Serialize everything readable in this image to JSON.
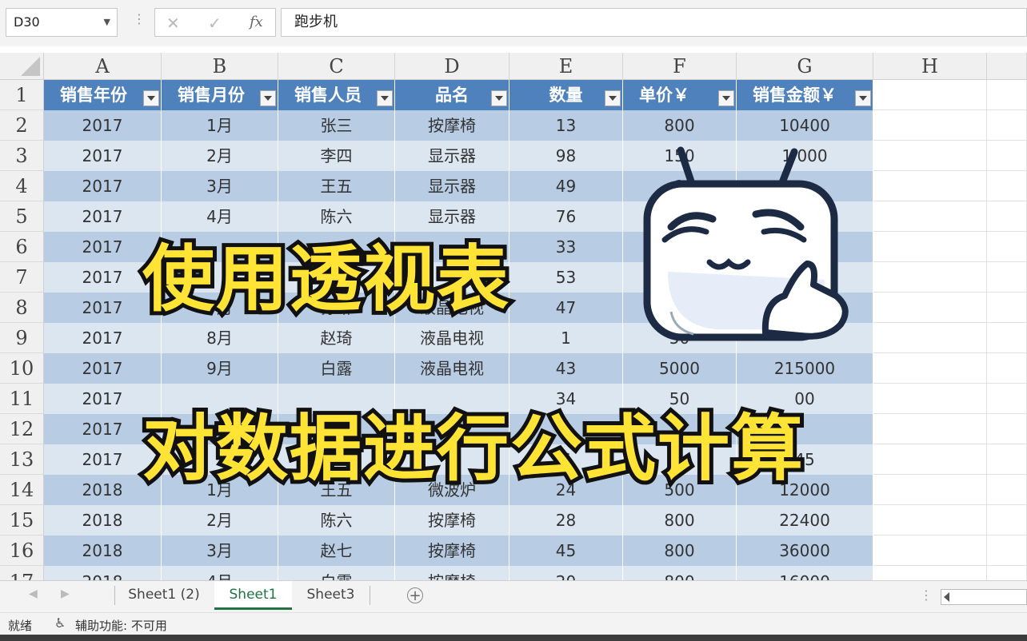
{
  "formula_bar": {
    "name_box": "D30",
    "cancel_icon": "✕",
    "confirm_icon": "✓",
    "fx_icon": "fx",
    "content": "跑步机"
  },
  "columns": [
    "A",
    "B",
    "C",
    "D",
    "E",
    "F",
    "G",
    "H"
  ],
  "table": {
    "headers": [
      "销售年份",
      "销售月份",
      "销售人员",
      "品名",
      "数量",
      "单价￥",
      "销售金额￥"
    ],
    "rows": [
      [
        "2017",
        "1月",
        "张三",
        "按摩椅",
        "13",
        "800",
        "10400"
      ],
      [
        "2017",
        "2月",
        "李四",
        "显示器",
        "98",
        "150",
        "1  000"
      ],
      [
        "2017",
        "3月",
        "王五",
        "显示器",
        "49",
        "1",
        ""
      ],
      [
        "2017",
        "4月",
        "陈六",
        "显示器",
        "76",
        "",
        ""
      ],
      [
        "2017",
        "",
        "",
        "",
        "33",
        "",
        ""
      ],
      [
        "2017",
        "",
        "",
        "",
        "53",
        "",
        ""
      ],
      [
        "2017",
        "7月",
        "孙琳",
        "液晶电视",
        "47",
        "",
        ""
      ],
      [
        "2017",
        "8月",
        "赵琦",
        "液晶电视",
        "1",
        "50",
        ""
      ],
      [
        "2017",
        "9月",
        "白露",
        "液晶电视",
        "43",
        "5000",
        "215000"
      ],
      [
        "2017",
        "",
        "",
        "",
        "34",
        "50",
        "00"
      ],
      [
        "2017",
        "",
        "",
        "",
        "",
        "",
        ""
      ],
      [
        "2017",
        "",
        "",
        "",
        "6",
        "",
        "45"
      ],
      [
        "2018",
        "1月",
        "王五",
        "微波炉",
        "24",
        "500",
        "12000"
      ],
      [
        "2018",
        "2月",
        "陈六",
        "按摩椅",
        "28",
        "800",
        "22400"
      ],
      [
        "2018",
        "3月",
        "赵七",
        "按摩椅",
        "45",
        "800",
        "36000"
      ],
      [
        "2018",
        "4月",
        "白露",
        "按摩椅",
        "20",
        "800",
        "16000"
      ]
    ]
  },
  "overlay": {
    "line1": "使用透视表",
    "line2": "对数据进行公式计算"
  },
  "sheet_tabs": [
    "Sheet1 (2)",
    "Sheet1",
    "Sheet3"
  ],
  "active_tab_index": 1,
  "add_sheet": "+",
  "status": {
    "ready": "就绪",
    "accessibility": "辅助功能: 不可用"
  },
  "colors": {
    "header_blue": "#4f81bd",
    "band_dark": "#b8cce4",
    "band_light": "#dce6f1",
    "overlay_yellow": "#ffe335",
    "excel_green": "#217346"
  }
}
